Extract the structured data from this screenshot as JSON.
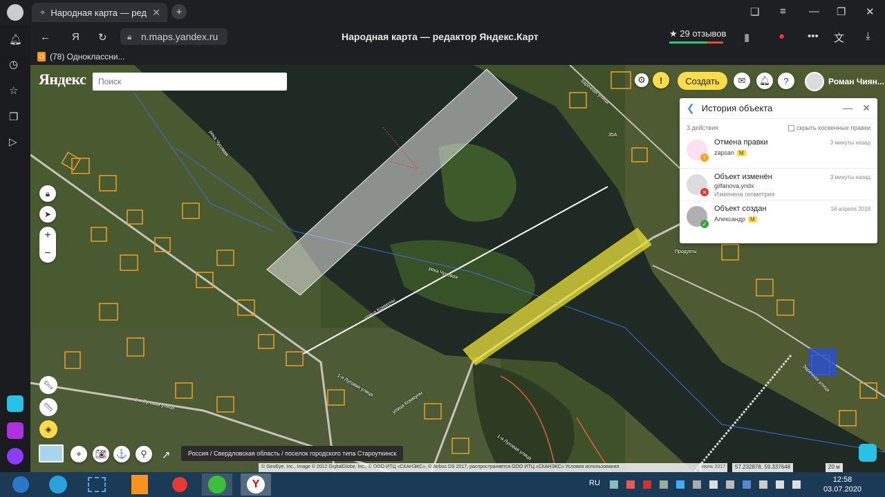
{
  "browser": {
    "tab_title": "Народная карта — редактор Яндекс.Карт",
    "url": "n.maps.yandex.ru",
    "page_title": "Народная карта — редактор Яндекс.Карт",
    "reviews": "★ 29 отзывов",
    "bookmark": "(78) Одноклассни..."
  },
  "map": {
    "logo": "Яндекс",
    "search_placeholder": "Поиск",
    "create_label": "Создать",
    "user_name": "Роман Чиян...",
    "breadcrumb": "Россия / Свердловская область / поселок городского типа Староуткинск",
    "copyright": "© GeoEye, Inc., Image © 2012 DigitalGlobe, Inc., © ООО ИТЦ «СКАНЭКС», © Airbus DS 2017, распространяется ООО ИТЦ «СКАНЭКС» Условия использования",
    "imagery_date": "июнь 2017",
    "coords": "57.232878, 59.337648",
    "scale": "20 м",
    "labels": {
      "river1": "река Чусовая",
      "river2": "река Чусовая",
      "street1": "улица Коммуны",
      "street2": "улица Коммуны",
      "street3": "1-я Луговая улица",
      "street4": "2-я Луговая улица",
      "street5": "Заречная улица",
      "street6": "Заречная улица",
      "street7": "1-я Луговая улица",
      "shop": "Продукты",
      "house_35a": "35А"
    }
  },
  "history": {
    "title": "История объекта",
    "count": "3 действия",
    "hide_indirect": "скрыть косвенные правки",
    "items": [
      {
        "title": "Отмена правки",
        "time": "3 минуты назад",
        "user": "zapsan",
        "badge": "М",
        "note": "",
        "status": "warn"
      },
      {
        "title": "Объект изменён",
        "time": "3 минуты назад",
        "user": "gilfanova.yndx",
        "badge": "",
        "note": "Изменена геометрия",
        "status": "err"
      },
      {
        "title": "Объект создан",
        "time": "16 апреля 2019",
        "user": "Александр",
        "badge": "М",
        "note": "",
        "status": "ok"
      }
    ]
  },
  "taskbar": {
    "lang": "RU",
    "time": "12:58",
    "date": "03.07.2020"
  }
}
